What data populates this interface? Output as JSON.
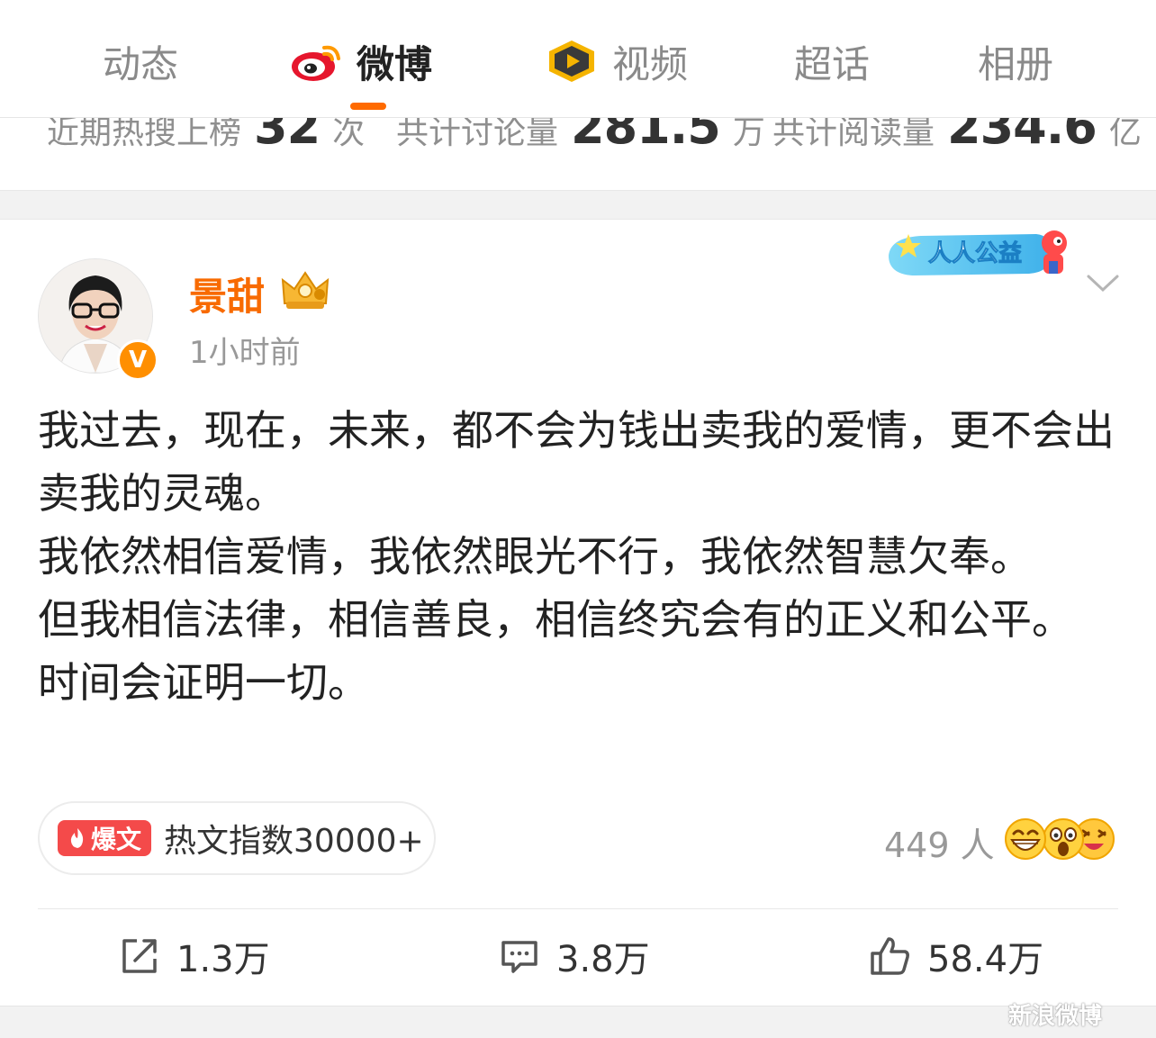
{
  "tabs": [
    {
      "label": "动态",
      "active": false
    },
    {
      "label": "微博",
      "active": true
    },
    {
      "label": "视频",
      "active": false
    },
    {
      "label": "超话",
      "active": false
    },
    {
      "label": "相册",
      "active": false
    }
  ],
  "stats": [
    {
      "label": "近期热搜上榜",
      "value": "32",
      "unit": "次"
    },
    {
      "label": "共计讨论量",
      "value": "281.5",
      "unit": "万"
    },
    {
      "label": "共计阅读量",
      "value": "234.6",
      "unit": "亿"
    }
  ],
  "post": {
    "username": "景甜",
    "timestamp": "1小时前",
    "verified_mark": "V",
    "campaign_badge": "人人公益",
    "paragraphs": [
      "我过去，现在，未来，都不会为钱出卖我的爱情，更不会出卖我的灵魂。",
      "我依然相信爱情，我依然眼光不行，我依然智慧欠奉。",
      "但我相信法律，相信善良，相信终究会有的正义和公平。",
      "时间会证明一切。"
    ],
    "hot_tag": "爆文",
    "hot_text": "热文指数30000+",
    "reactions_count": "449 人",
    "reaction_emojis": [
      "grin-emoji",
      "shocked-emoji",
      "laughing-emoji"
    ]
  },
  "actions": {
    "repost": "1.3万",
    "comment": "3.8万",
    "like": "58.4万"
  },
  "colors": {
    "accent": "#ff6a00",
    "username": "#f86a00",
    "hot_tag": "#f44a4a"
  },
  "watermark": "新浪微博"
}
